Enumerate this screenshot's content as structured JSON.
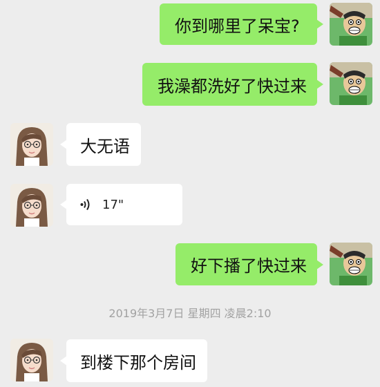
{
  "messages": [
    {
      "id": "m1",
      "side": "out",
      "kind": "text",
      "text": "你到哪里了呆宝?"
    },
    {
      "id": "m2",
      "side": "out",
      "kind": "text",
      "text": "我澡都洗好了快过来"
    },
    {
      "id": "m3",
      "side": "in",
      "kind": "text",
      "text": "大无语"
    },
    {
      "id": "m4",
      "side": "in",
      "kind": "voice",
      "duration": "17\""
    },
    {
      "id": "m5",
      "side": "out",
      "kind": "text",
      "text": "好下播了快过来"
    },
    {
      "id": "m6",
      "side": "in",
      "kind": "text",
      "text": "到楼下那个房间"
    }
  ],
  "timestamp": "2019年3月7日 星期四 凌晨2:10",
  "colors": {
    "background": "#ededed",
    "outgoing_bubble": "#95ec69",
    "incoming_bubble": "#ffffff",
    "timestamp_text": "#a2a2a2"
  },
  "icons": {
    "voice": "voice-wave-icon"
  }
}
